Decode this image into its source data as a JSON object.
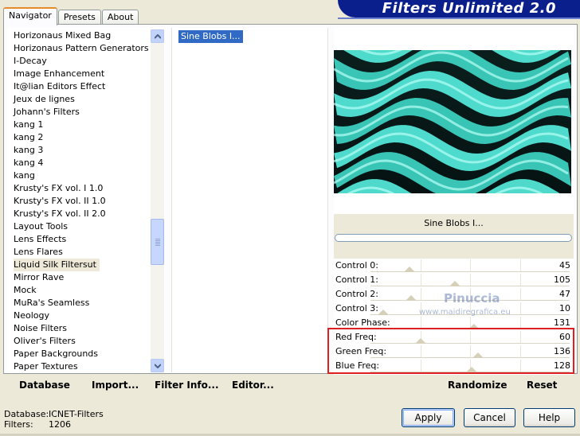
{
  "header": {
    "tabs": [
      "Navigator",
      "Presets",
      "About"
    ],
    "active_tab": "Navigator",
    "banner_title": "Filters Unlimited 2.0"
  },
  "categories": [
    "Horizonaus Mixed Bag",
    "Horizonaus Pattern Generators",
    "I-Decay",
    "Image Enhancement",
    "It@lian Editors Effect",
    "Jeux de lignes",
    "Johann's Filters",
    "kang 1",
    "kang 2",
    "kang 3",
    "kang 4",
    "kang",
    "Krusty's FX vol. I 1.0",
    "Krusty's FX vol. II 1.0",
    "Krusty's FX vol. II 2.0",
    "Layout Tools",
    "Lens Effects",
    "Lens Flares",
    "Liquid Silk Filtersut",
    "Mirror Rave",
    "Mock",
    "MuRa's Seamless",
    "Neology",
    "Noise Filters",
    "Oliver's Filters",
    "Paper Backgrounds",
    "Paper Textures"
  ],
  "selected_category": "Liquid Silk Filtersut",
  "filters": [
    "Sine Blobs I..."
  ],
  "selected_filter": "Sine Blobs I...",
  "preview": {
    "filter_name": "Sine Blobs I..."
  },
  "controls": [
    {
      "label": "Control 0:",
      "value": "45"
    },
    {
      "label": "Control 1:",
      "value": "105"
    },
    {
      "label": "Control 2:",
      "value": "47"
    },
    {
      "label": "Control 3:",
      "value": "10"
    },
    {
      "label": "Color Phase:",
      "value": "131"
    },
    {
      "label": "Red Freq:",
      "value": "60"
    },
    {
      "label": "Green Freq:",
      "value": "136"
    },
    {
      "label": "Blue Freq:",
      "value": "128"
    }
  ],
  "watermark": {
    "name": "Pinuccia",
    "url": "www.maidiregrafica.eu"
  },
  "buttons": {
    "database": "Database",
    "import": "Import...",
    "filter_info": "Filter Info...",
    "editor": "Editor...",
    "randomize": "Randomize",
    "reset": "Reset",
    "apply": "Apply",
    "cancel": "Cancel",
    "help": "Help"
  },
  "status": {
    "database_label": "Database:",
    "database_value": "ICNET-Filters",
    "filters_label": "Filters:",
    "filters_value": "1206"
  },
  "colors": {
    "banner": "#0a1e8c",
    "selection": "#316ac5",
    "highlight_box": "#e02020",
    "preview_cyan": "#4de8d8"
  },
  "scrollbar": {
    "position_fraction": 0.61
  }
}
